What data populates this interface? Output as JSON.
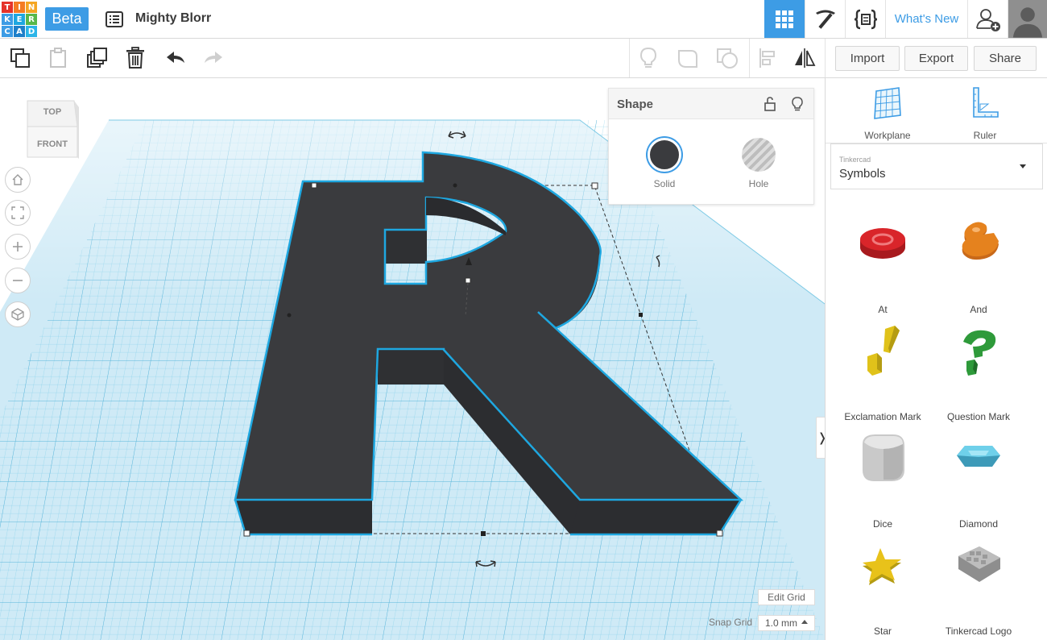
{
  "app": {
    "logo_letters": [
      "T",
      "I",
      "N",
      "K",
      "E",
      "R",
      "C",
      "A",
      "D"
    ],
    "logo_colors": [
      "#e5332a",
      "#f57c23",
      "#f5a623",
      "#3d9ce5",
      "#1ea7e0",
      "#58b84a",
      "#3d9ce5",
      "#1e7fc9",
      "#2cb5e8"
    ],
    "beta_label": "Beta",
    "design_title": "Mighty Blorr",
    "whats_new_label": "What's New"
  },
  "toolbar": {
    "import_label": "Import",
    "export_label": "Export",
    "share_label": "Share"
  },
  "viewcube": {
    "top_label": "TOP",
    "front_label": "FRONT"
  },
  "inspector": {
    "title": "Shape",
    "solid_label": "Solid",
    "hole_label": "Hole",
    "solid_color": "#3a3b3e"
  },
  "viewport": {
    "edit_grid_label": "Edit Grid",
    "snap_grid_label": "Snap Grid",
    "snap_grid_value": "1.0 mm",
    "collapse_glyph": "❭"
  },
  "panel": {
    "workplane_label": "Workplane",
    "ruler_label": "Ruler",
    "library_brand": "Tinkercad",
    "library_value": "Symbols",
    "shapes": [
      {
        "label": "At",
        "icon": "at-icon",
        "color": "#d9252a"
      },
      {
        "label": "And",
        "icon": "ampersand-icon",
        "color": "#e5821e"
      },
      {
        "label": "Exclamation Mark",
        "icon": "exclamation-icon",
        "color": "#e0c21a"
      },
      {
        "label": "Question Mark",
        "icon": "question-icon",
        "color": "#2e9a3a"
      },
      {
        "label": "Dice",
        "icon": "dice-icon",
        "color": "#c9c9c9"
      },
      {
        "label": "Diamond",
        "icon": "diamond-icon",
        "color": "#4fb8d6"
      },
      {
        "label": "Star",
        "icon": "star-icon",
        "color": "#e8c21a"
      },
      {
        "label": "Tinkercad Logo",
        "icon": "tinkercad-logo-icon",
        "color": "#a9a9a9"
      }
    ]
  }
}
